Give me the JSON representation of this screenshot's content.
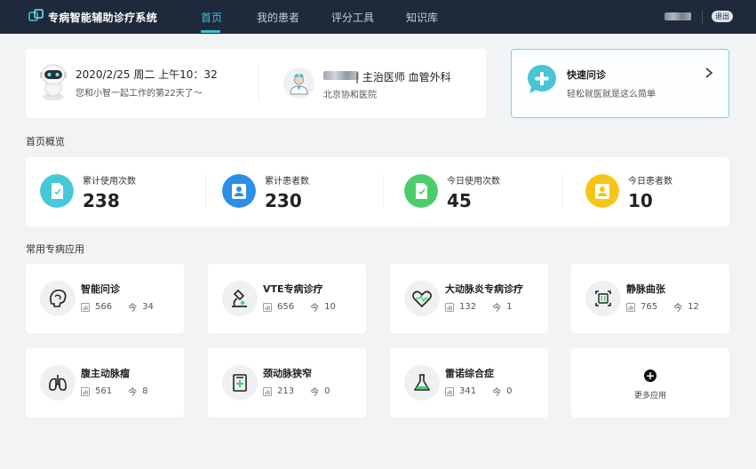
{
  "app": {
    "title": "专病智能辅助诊疗系统"
  },
  "nav": {
    "tabs": [
      {
        "label": "首页",
        "active": true
      },
      {
        "label": "我的患者",
        "active": false
      },
      {
        "label": "评分工具",
        "active": false
      },
      {
        "label": "知识库",
        "active": false
      }
    ],
    "logout_label": "退出"
  },
  "info": {
    "date": "2020/2/25 周二 上午10：32",
    "greeting": "您和小智一起工作的第22天了～",
    "doctor_title": "| 主治医师  血管外科",
    "hospital": "北京协和医院"
  },
  "quick": {
    "title": "快速问诊",
    "subtitle": "轻松就医就是这么简单"
  },
  "overview": {
    "title": "首页概览",
    "stats": [
      {
        "label": "累计使用次数",
        "value": "238",
        "color": "#45c9d9",
        "icon": "document-icon"
      },
      {
        "label": "累计患者数",
        "value": "230",
        "color": "#2d8ee6",
        "icon": "user-icon"
      },
      {
        "label": "今日使用次数",
        "value": "45",
        "color": "#4ccd6c",
        "icon": "document-icon"
      },
      {
        "label": "今日患者数",
        "value": "10",
        "color": "#f5c518",
        "icon": "user-icon"
      }
    ]
  },
  "apps": {
    "title": "常用专病应用",
    "today_char": "今",
    "items": [
      {
        "name": "智能问诊",
        "total": "566",
        "today": "34",
        "icon": "brain-icon"
      },
      {
        "name": "VTE专病诊疗",
        "total": "656",
        "today": "10",
        "icon": "microscope-icon"
      },
      {
        "name": "大动脉炎专病诊疗",
        "total": "132",
        "today": "1",
        "icon": "heart-pulse-icon"
      },
      {
        "name": "静脉曲张",
        "total": "765",
        "today": "12",
        "icon": "vein-icon"
      },
      {
        "name": "腹主动脉瘤",
        "total": "561",
        "today": "8",
        "icon": "lungs-icon"
      },
      {
        "name": "颈动脉狭窄",
        "total": "213",
        "today": "0",
        "icon": "medical-record-icon"
      },
      {
        "name": "雷诺综合症",
        "total": "341",
        "today": "0",
        "icon": "flask-icon"
      }
    ],
    "more_label": "更多应用"
  }
}
